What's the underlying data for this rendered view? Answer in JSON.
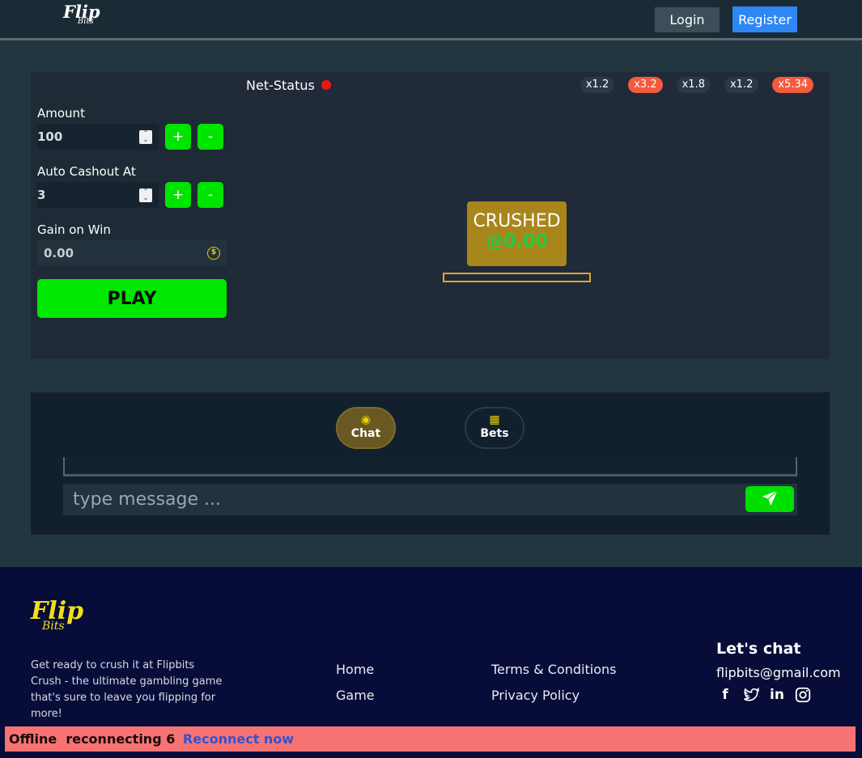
{
  "header": {
    "logo_main": "Flip",
    "logo_sub": "Bits",
    "login_label": "Login",
    "register_label": "Register"
  },
  "controls": {
    "amount_label": "Amount",
    "amount_value": "100",
    "auto_cashout_label": "Auto Cashout At",
    "auto_cashout_value": "3",
    "plus_label": "+",
    "minus_label": "-",
    "gain_label": "Gain on Win",
    "gain_value": "0.00",
    "gain_icon": "coin-icon",
    "play_label": "PLAY"
  },
  "game": {
    "net_status_label": "Net-Status",
    "net_status_color": "#ee1515",
    "multipliers": [
      {
        "label": "x1.2",
        "hot": false
      },
      {
        "label": "x3.2",
        "hot": true
      },
      {
        "label": "x1.8",
        "hot": false
      },
      {
        "label": "x1.2",
        "hot": false
      },
      {
        "label": "x5.34",
        "hot": true
      }
    ],
    "crush_title": "CRUSHED",
    "crush_value": "@0.00",
    "progress_fraction": 0
  },
  "chat": {
    "tabs": [
      {
        "label": "Chat",
        "icon": "chat-bubbles-icon",
        "active": true
      },
      {
        "label": "Bets",
        "icon": "grid-icon",
        "active": false
      }
    ],
    "input_placeholder": "type message ...",
    "send_icon": "paper-plane-icon"
  },
  "footer": {
    "logo_main": "Flip",
    "logo_sub": "Bits",
    "description": "Get ready to crush it at Flipbits Crush - the ultimate gambling game that's sure to leave you flipping for more!",
    "links_col1": [
      "Home",
      "Game"
    ],
    "links_col2": [
      "Terms & Conditions",
      "Privacy Policy"
    ],
    "chat_title": "Let's chat",
    "email": "flipbits@gmail.com",
    "socials": [
      "facebook-icon",
      "twitter-icon",
      "linkedin-icon",
      "instagram-icon"
    ]
  },
  "offline": {
    "status": "Offline",
    "reconnect_text": "reconnecting 6",
    "reconnect_link": "Reconnect now"
  },
  "colors": {
    "accent_green": "#00e700",
    "register_blue": "#2f86f5",
    "hot_multiplier": "#f35b3e",
    "crush_gold": "#a8861c",
    "offline_bar": "#f77373"
  }
}
